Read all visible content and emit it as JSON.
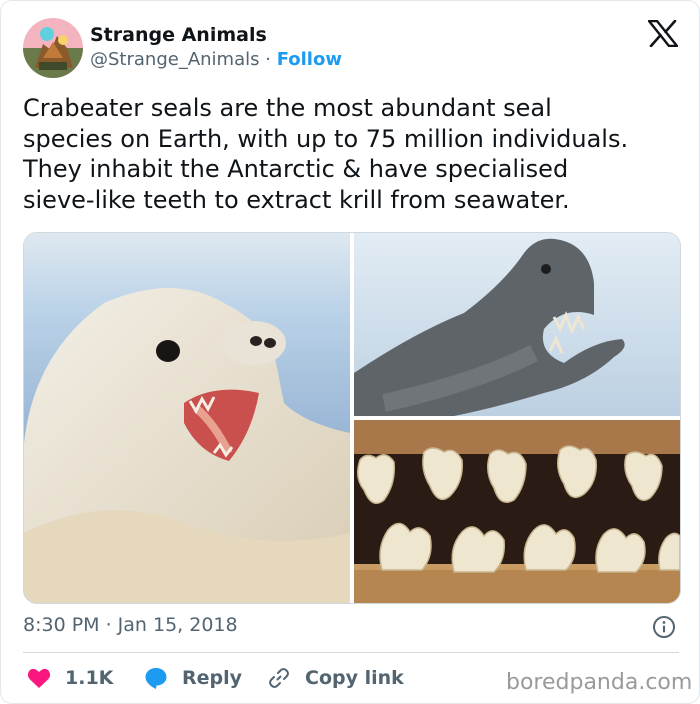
{
  "author": {
    "name": "Strange Animals",
    "handle": "@Strange_Animals",
    "separator": "·",
    "follow_label": "Follow"
  },
  "tweet": {
    "lines": [
      "Crabeater seals are the most abundant seal",
      "species on Earth, with up to 75 million individuals.",
      "They inhabit the Antarctic & have specialised",
      "sieve-like teeth to extract krill from seawater."
    ],
    "timestamp": "8:30 PM · Jan 15, 2018"
  },
  "actions": {
    "likes": "1.1K",
    "reply_label": "Reply",
    "copy_label": "Copy link"
  },
  "watermark": "boredpanda.com",
  "icons": {
    "x_logo": "x-logo-icon",
    "info": "info-icon",
    "heart": "heart-icon",
    "reply": "reply-bubble-icon",
    "link": "link-icon"
  },
  "colors": {
    "link": "#1d9bf0",
    "heart": "#f91880",
    "reply_bubble": "#1d9bf0",
    "secondary_text": "#536471",
    "watermark": "#9a9a9a"
  }
}
